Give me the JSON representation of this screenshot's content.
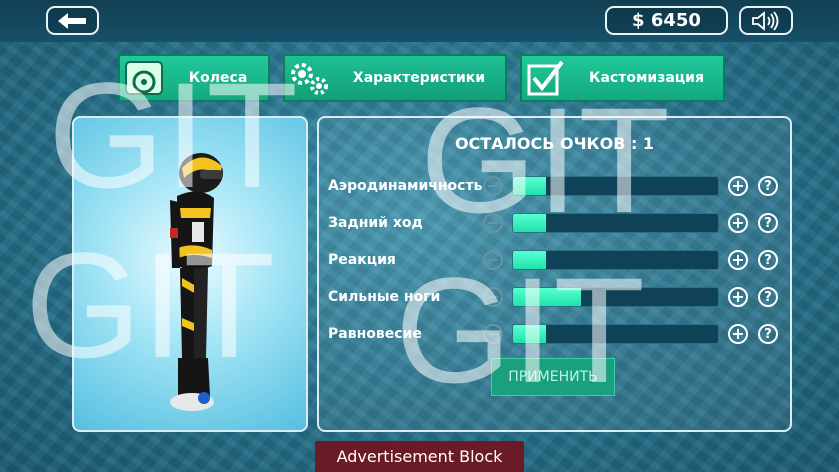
{
  "money": "$ 6450",
  "tabs": [
    {
      "label": "Колеса",
      "icon": "wheel-icon"
    },
    {
      "label": "Характеристики",
      "icon": "gears-icon"
    },
    {
      "label": "Кастомизация",
      "icon": "checkbox-icon"
    }
  ],
  "points_label": "ОСТАЛОСЬ ОЧКОВ : 1",
  "stats": [
    {
      "label": "Аэродинамичность",
      "level": 0.16
    },
    {
      "label": "Задний ход",
      "level": 0.16
    },
    {
      "label": "Реакция",
      "level": 0.16
    },
    {
      "label": "Сильные ноги",
      "level": 0.33
    },
    {
      "label": "Равновесие",
      "level": 0.16
    }
  ],
  "minus_symbol": "−",
  "plus_symbol": "+",
  "help_symbol": "?",
  "apply_label": "ПРИМЕНИТЬ",
  "ad_label": "Advertisement Block",
  "watermark_text": "GIT",
  "colors": {
    "accent": "#1fe3a9",
    "tab": "#17b68a",
    "ad": "#6b1b26"
  }
}
